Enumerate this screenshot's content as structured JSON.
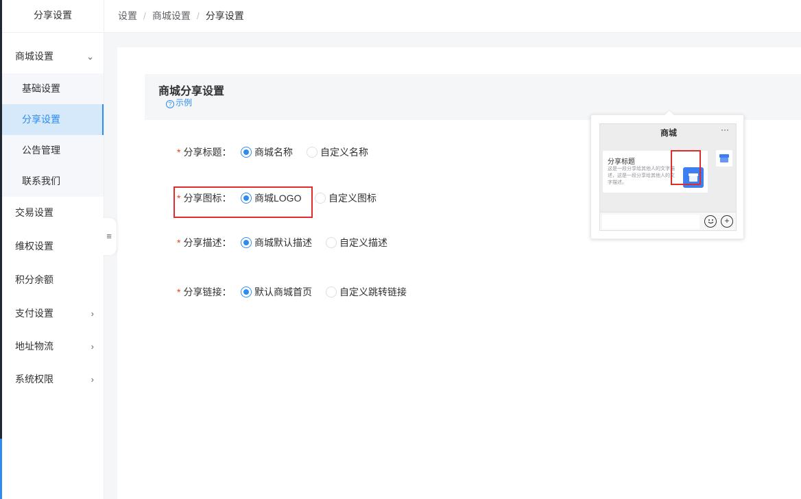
{
  "sidebar": {
    "header": "分享设置",
    "items": [
      {
        "label": "商城设置",
        "expanded": true
      },
      {
        "label": "交易设置"
      },
      {
        "label": "维权设置"
      },
      {
        "label": "积分余额"
      },
      {
        "label": "支付设置"
      },
      {
        "label": "地址物流"
      },
      {
        "label": "系统权限"
      }
    ],
    "subitems": [
      {
        "label": "基础设置"
      },
      {
        "label": "分享设置",
        "active": true
      },
      {
        "label": "公告管理"
      },
      {
        "label": "联系我们"
      }
    ]
  },
  "breadcrumb": [
    "设置",
    "商城设置",
    "分享设置"
  ],
  "section": {
    "title": "商城分享设置",
    "example_label": "示例"
  },
  "form": {
    "share_title": {
      "label": "分享标题：",
      "options": [
        "商城名称",
        "自定义名称"
      ],
      "selected": "商城名称"
    },
    "share_icon": {
      "label": "分享图标：",
      "options": [
        "商城LOGO",
        "自定义图标"
      ],
      "selected": "商城LOGO"
    },
    "share_desc": {
      "label": "分享描述：",
      "options": [
        "商城默认描述",
        "自定义描述"
      ],
      "selected": "商城默认描述"
    },
    "share_link": {
      "label": "分享链接：",
      "options": [
        "默认商城首页",
        "自定义跳转链接"
      ],
      "selected": "默认商城首页"
    }
  },
  "preview": {
    "chat_title": "商城",
    "more": "···",
    "card_title": "分享标题",
    "card_desc": "这是一段分享给其他人的文字描述，这是一段分享给其他人的文字描述。"
  },
  "colors": {
    "accent": "#2d8cf0",
    "highlight": "#e02b2b",
    "required": "#ed4014"
  }
}
